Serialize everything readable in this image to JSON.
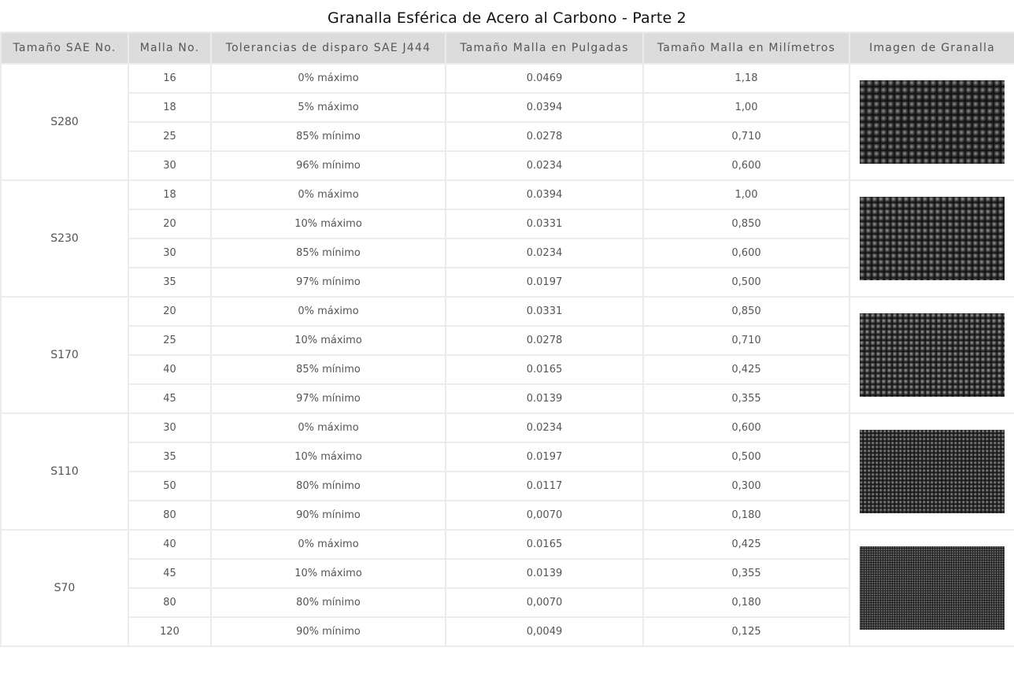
{
  "title": "Granalla Esférica de Acero al Carbono - Parte 2",
  "headers": [
    "Tamaño SAE No.",
    "Malla No.",
    "Tolerancias de disparo SAE J444",
    "Tamaño Malla en Pulgadas",
    "Tamaño Malla en Milímetros",
    "Imagen de Granalla"
  ],
  "groups": [
    {
      "size": "S280",
      "image": "steel-shot-s280-photo",
      "rows": [
        {
          "mesh": "16",
          "tolerance": "0% máximo",
          "inches": "0.0469",
          "mm": "1,18"
        },
        {
          "mesh": "18",
          "tolerance": "5% máximo",
          "inches": "0.0394",
          "mm": "1,00"
        },
        {
          "mesh": "25",
          "tolerance": "85% mínimo",
          "inches": "0.0278",
          "mm": "0,710"
        },
        {
          "mesh": "30",
          "tolerance": "96% mínimo",
          "inches": "0.0234",
          "mm": "0,600"
        }
      ]
    },
    {
      "size": "S230",
      "image": "steel-shot-s230-photo",
      "rows": [
        {
          "mesh": "18",
          "tolerance": "0% máximo",
          "inches": "0.0394",
          "mm": "1,00"
        },
        {
          "mesh": "20",
          "tolerance": "10% máximo",
          "inches": "0.0331",
          "mm": "0,850"
        },
        {
          "mesh": "30",
          "tolerance": "85% mínimo",
          "inches": "0.0234",
          "mm": "0,600"
        },
        {
          "mesh": "35",
          "tolerance": "97% mínimo",
          "inches": "0.0197",
          "mm": "0,500"
        }
      ]
    },
    {
      "size": "S170",
      "image": "steel-shot-s170-photo",
      "rows": [
        {
          "mesh": "20",
          "tolerance": "0% máximo",
          "inches": "0.0331",
          "mm": "0,850"
        },
        {
          "mesh": "25",
          "tolerance": "10% máximo",
          "inches": "0.0278",
          "mm": "0,710"
        },
        {
          "mesh": "40",
          "tolerance": "85% mínimo",
          "inches": "0.0165",
          "mm": "0,425"
        },
        {
          "mesh": "45",
          "tolerance": "97% mínimo",
          "inches": "0.0139",
          "mm": "0,355"
        }
      ]
    },
    {
      "size": "S110",
      "image": "steel-shot-s110-photo",
      "rows": [
        {
          "mesh": "30",
          "tolerance": "0% máximo",
          "inches": "0.0234",
          "mm": "0,600"
        },
        {
          "mesh": "35",
          "tolerance": "10% máximo",
          "inches": "0.0197",
          "mm": "0,500"
        },
        {
          "mesh": "50",
          "tolerance": "80% mínimo",
          "inches": "0.0117",
          "mm": "0,300"
        },
        {
          "mesh": "80",
          "tolerance": "90% mínimo",
          "inches": "0,0070",
          "mm": "0,180"
        }
      ]
    },
    {
      "size": "S70",
      "image": "steel-shot-s70-photo",
      "rows": [
        {
          "mesh": "40",
          "tolerance": "0% máximo",
          "inches": "0.0165",
          "mm": "0,425"
        },
        {
          "mesh": "45",
          "tolerance": "10% máximo",
          "inches": "0.0139",
          "mm": "0,355"
        },
        {
          "mesh": "80",
          "tolerance": "80% mínimo",
          "inches": "0,0070",
          "mm": "0,180"
        },
        {
          "mesh": "120",
          "tolerance": "90% mínimo",
          "inches": "0,0049",
          "mm": "0,125"
        }
      ]
    }
  ]
}
